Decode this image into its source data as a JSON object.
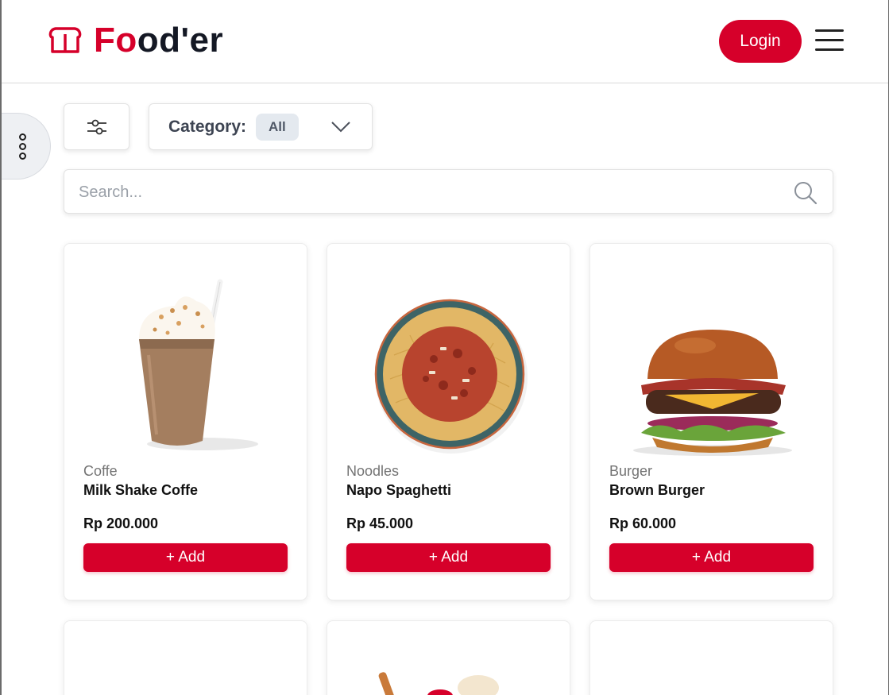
{
  "brand": {
    "prefix_red": "Fo",
    "suffix": "od'er",
    "accent_color": "#d6002a"
  },
  "header": {
    "login_label": "Login"
  },
  "filters": {
    "category_label": "Category:",
    "category_value": "All"
  },
  "search": {
    "placeholder": "Search..."
  },
  "products": [
    {
      "category": "Coffe",
      "name": "Milk Shake Coffe",
      "price": "Rp 200.000",
      "add_label": "+ Add",
      "image": "milkshake"
    },
    {
      "category": "Noodles",
      "name": "Napo Spaghetti",
      "price": "Rp 45.000",
      "add_label": "+ Add",
      "image": "spaghetti"
    },
    {
      "category": "Burger",
      "name": "Brown Burger",
      "price": "Rp 60.000",
      "add_label": "+ Add",
      "image": "burger"
    }
  ],
  "icons": {
    "brand": "toast-bread-icon",
    "menu": "hamburger-menu-icon",
    "side_toggle": "more-vertical-icon",
    "filter": "sliders-icon",
    "dropdown": "chevron-down-icon",
    "search": "search-icon"
  }
}
